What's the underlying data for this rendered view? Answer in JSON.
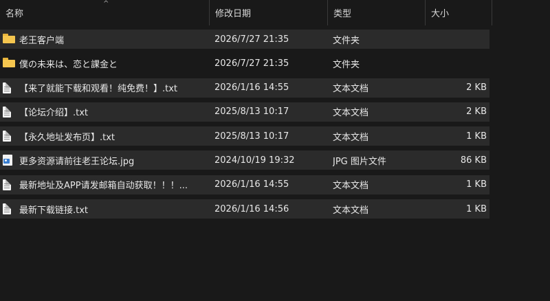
{
  "columns": {
    "name": "名称",
    "date": "修改日期",
    "type": "类型",
    "size": "大小",
    "sort_indicator": "^"
  },
  "files": [
    {
      "name": "老王客户端",
      "date": "2026/7/27 21:35",
      "type": "文件夹",
      "size": "",
      "icon": "folder-icon"
    },
    {
      "name": "僕の未来は、恋と課金と",
      "date": "2026/7/27 21:35",
      "type": "文件夹",
      "size": "",
      "icon": "folder-icon"
    },
    {
      "name": "【来了就能下载和观看！纯免费！】.txt",
      "date": "2026/1/16 14:55",
      "type": "文本文档",
      "size": "2 KB",
      "icon": "text-document-icon"
    },
    {
      "name": "【论坛介绍】.txt",
      "date": "2025/8/13 10:17",
      "type": "文本文档",
      "size": "2 KB",
      "icon": "text-document-icon"
    },
    {
      "name": "【永久地址发布页】.txt",
      "date": "2025/8/13 10:17",
      "type": "文本文档",
      "size": "1 KB",
      "icon": "text-document-icon"
    },
    {
      "name": "更多资源请前往老王论坛.jpg",
      "date": "2024/10/19 19:32",
      "type": "JPG 图片文件",
      "size": "86 KB",
      "icon": "image-file-icon"
    },
    {
      "name": "最新地址及APP请发邮箱自动获取！！！...",
      "date": "2026/1/16 14:55",
      "type": "文本文档",
      "size": "1 KB",
      "icon": "text-document-icon"
    },
    {
      "name": "最新下载链接.txt",
      "date": "2026/1/16 14:56",
      "type": "文本文档",
      "size": "1 KB",
      "icon": "text-document-icon"
    }
  ],
  "colors": {
    "background": "#191919",
    "row_highlight": "#2b2b2b",
    "folder": "#f5c64f",
    "text": "#e8e8e8"
  }
}
